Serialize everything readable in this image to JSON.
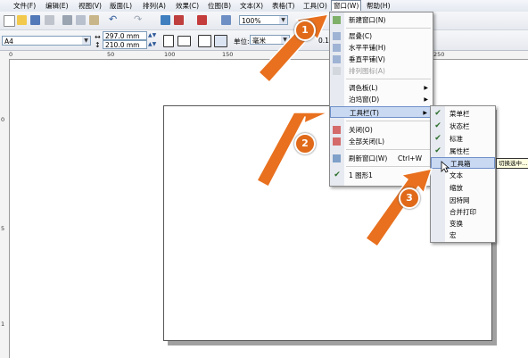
{
  "menubar": {
    "items": [
      "文件(F)",
      "编辑(E)",
      "视图(V)",
      "版面(L)",
      "排列(A)",
      "效果(C)",
      "位图(B)",
      "文本(X)",
      "表格(T)",
      "工具(O)",
      "窗口(W)",
      "帮助(H)"
    ]
  },
  "toolbar": {
    "zoom": "100%",
    "paper": "A4",
    "width": "297.0 mm",
    "height": "210.0 mm",
    "unit_label": "单位:",
    "unit_value": "毫米",
    "nudge_partial": "0.1"
  },
  "ruler": {
    "h_labels": [
      "0",
      "50",
      "100",
      "150",
      "200",
      "250"
    ],
    "v_labels": [
      "0",
      "5",
      "1"
    ]
  },
  "window_menu": {
    "items": [
      "新建窗口(N)",
      "层叠(C)",
      "水平平铺(H)",
      "垂直平铺(V)",
      "排列图标(A)",
      "调色板(L)",
      "泊坞窗(D)",
      "工具栏(T)",
      "关闭(O)",
      "全部关闭(L)",
      "刷新窗口(W)",
      "1 图形1"
    ],
    "refresh_shortcut": "Ctrl+W"
  },
  "toolbar_submenu": {
    "items": [
      "菜单栏",
      "状态栏",
      "标准",
      "属性栏",
      "工具箱",
      "文本",
      "缩放",
      "因特网",
      "合并打印",
      "变换",
      "宏"
    ]
  },
  "tooltip": "切换选中…",
  "badges": [
    "1",
    "2",
    "3"
  ],
  "colors": {
    "arrow": "#e8701e",
    "highlight": "#c9d9f2"
  }
}
